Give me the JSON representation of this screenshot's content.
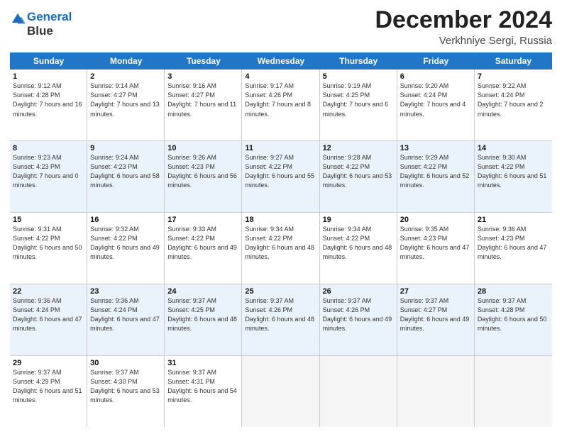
{
  "logo": {
    "line1": "General",
    "line2": "Blue"
  },
  "header": {
    "month": "December 2024",
    "location": "Verkhniye Sergi, Russia"
  },
  "days": [
    "Sunday",
    "Monday",
    "Tuesday",
    "Wednesday",
    "Thursday",
    "Friday",
    "Saturday"
  ],
  "weeks": [
    [
      {
        "num": "1",
        "rise": "9:12 AM",
        "set": "4:28 PM",
        "daylight": "7 hours and 16 minutes."
      },
      {
        "num": "2",
        "rise": "9:14 AM",
        "set": "4:27 PM",
        "daylight": "7 hours and 13 minutes."
      },
      {
        "num": "3",
        "rise": "9:16 AM",
        "set": "4:27 PM",
        "daylight": "7 hours and 11 minutes."
      },
      {
        "num": "4",
        "rise": "9:17 AM",
        "set": "4:26 PM",
        "daylight": "7 hours and 8 minutes."
      },
      {
        "num": "5",
        "rise": "9:19 AM",
        "set": "4:25 PM",
        "daylight": "7 hours and 6 minutes."
      },
      {
        "num": "6",
        "rise": "9:20 AM",
        "set": "4:24 PM",
        "daylight": "7 hours and 4 minutes."
      },
      {
        "num": "7",
        "rise": "9:22 AM",
        "set": "4:24 PM",
        "daylight": "7 hours and 2 minutes."
      }
    ],
    [
      {
        "num": "8",
        "rise": "9:23 AM",
        "set": "4:23 PM",
        "daylight": "7 hours and 0 minutes."
      },
      {
        "num": "9",
        "rise": "9:24 AM",
        "set": "4:23 PM",
        "daylight": "6 hours and 58 minutes."
      },
      {
        "num": "10",
        "rise": "9:26 AM",
        "set": "4:23 PM",
        "daylight": "6 hours and 56 minutes."
      },
      {
        "num": "11",
        "rise": "9:27 AM",
        "set": "4:22 PM",
        "daylight": "6 hours and 55 minutes."
      },
      {
        "num": "12",
        "rise": "9:28 AM",
        "set": "4:22 PM",
        "daylight": "6 hours and 53 minutes."
      },
      {
        "num": "13",
        "rise": "9:29 AM",
        "set": "4:22 PM",
        "daylight": "6 hours and 52 minutes."
      },
      {
        "num": "14",
        "rise": "9:30 AM",
        "set": "4:22 PM",
        "daylight": "6 hours and 51 minutes."
      }
    ],
    [
      {
        "num": "15",
        "rise": "9:31 AM",
        "set": "4:22 PM",
        "daylight": "6 hours and 50 minutes."
      },
      {
        "num": "16",
        "rise": "9:32 AM",
        "set": "4:22 PM",
        "daylight": "6 hours and 49 minutes."
      },
      {
        "num": "17",
        "rise": "9:33 AM",
        "set": "4:22 PM",
        "daylight": "6 hours and 49 minutes."
      },
      {
        "num": "18",
        "rise": "9:34 AM",
        "set": "4:22 PM",
        "daylight": "6 hours and 48 minutes."
      },
      {
        "num": "19",
        "rise": "9:34 AM",
        "set": "4:22 PM",
        "daylight": "6 hours and 48 minutes."
      },
      {
        "num": "20",
        "rise": "9:35 AM",
        "set": "4:23 PM",
        "daylight": "6 hours and 47 minutes."
      },
      {
        "num": "21",
        "rise": "9:36 AM",
        "set": "4:23 PM",
        "daylight": "6 hours and 47 minutes."
      }
    ],
    [
      {
        "num": "22",
        "rise": "9:36 AM",
        "set": "4:24 PM",
        "daylight": "6 hours and 47 minutes."
      },
      {
        "num": "23",
        "rise": "9:36 AM",
        "set": "4:24 PM",
        "daylight": "6 hours and 47 minutes."
      },
      {
        "num": "24",
        "rise": "9:37 AM",
        "set": "4:25 PM",
        "daylight": "6 hours and 48 minutes."
      },
      {
        "num": "25",
        "rise": "9:37 AM",
        "set": "4:26 PM",
        "daylight": "6 hours and 48 minutes."
      },
      {
        "num": "26",
        "rise": "9:37 AM",
        "set": "4:26 PM",
        "daylight": "6 hours and 49 minutes."
      },
      {
        "num": "27",
        "rise": "9:37 AM",
        "set": "4:27 PM",
        "daylight": "6 hours and 49 minutes."
      },
      {
        "num": "28",
        "rise": "9:37 AM",
        "set": "4:28 PM",
        "daylight": "6 hours and 50 minutes."
      }
    ],
    [
      {
        "num": "29",
        "rise": "9:37 AM",
        "set": "4:29 PM",
        "daylight": "6 hours and 51 minutes."
      },
      {
        "num": "30",
        "rise": "9:37 AM",
        "set": "4:30 PM",
        "daylight": "6 hours and 53 minutes."
      },
      {
        "num": "31",
        "rise": "9:37 AM",
        "set": "4:31 PM",
        "daylight": "6 hours and 54 minutes."
      },
      null,
      null,
      null,
      null
    ]
  ]
}
